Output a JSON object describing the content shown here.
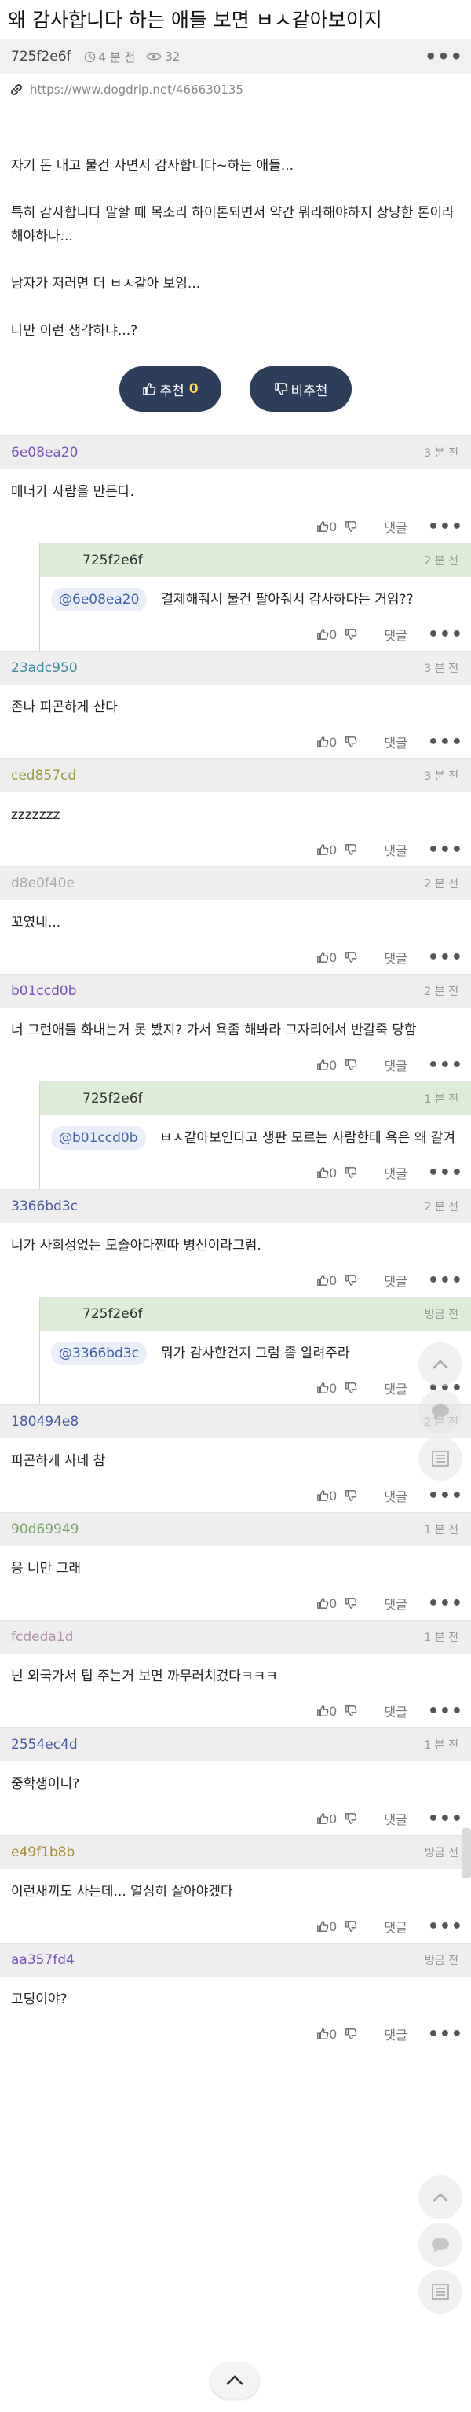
{
  "post": {
    "title": "왜 감사합니다 하는 애들 보면 ㅂㅅ같아보이지",
    "author": "725f2e6f",
    "time": "4 분 전",
    "views": "32",
    "more": "•••",
    "url": "https://www.dogdrip.net/466630135",
    "paragraphs": [
      "자기 돈 내고 물건 사면서 감사합니다~하는 애들...",
      "특히 감사합니다 말할 때 목소리 하이톤되면서 약간 뭐라해야하지 상냥한 톤이라 해야하나...",
      "남자가 저러면 더 ㅂㅅ같아 보임...",
      "나만 이런 생각하냐...?"
    ],
    "upvote_label": "추천",
    "upvote_count": "0",
    "downvote_label": "비추천"
  },
  "comment_ui": {
    "reply_label": "댓글",
    "dots": "•••",
    "zero": "0"
  },
  "comments": [
    {
      "author": "6e08ea20",
      "time": "3 분 전",
      "text": "매너가 사람을 만든다.",
      "color": "#7a53b8",
      "reply": false
    },
    {
      "author": "725f2e6f",
      "time": "2 분 전",
      "mention": "@6e08ea20",
      "text": "결제해줘서 물건 팔아줘서 감사하다는 거임??",
      "color": "#333333",
      "reply": true
    },
    {
      "author": "23adc950",
      "time": "3 분 전",
      "text": "존나 피곤하게 산다",
      "color": "#3d8aa0",
      "reply": false
    },
    {
      "author": "ced857cd",
      "time": "3 분 전",
      "text": "zzzzzzz",
      "color": "#9a9a3a",
      "reply": false
    },
    {
      "author": "d8e0f40e",
      "time": "2 분 전",
      "text": "꼬였네...",
      "color": "#aaaaaa",
      "reply": false
    },
    {
      "author": "b01ccd0b",
      "time": "2 분 전",
      "text": "너 그런애들 화내는거 못 봤지? 가서 욕좀 해봐라 그자리에서 반갈죽 당함",
      "color": "#7a53b8",
      "reply": false
    },
    {
      "author": "725f2e6f",
      "time": "1 분 전",
      "mention": "@b01ccd0b",
      "text": "ㅂㅅ같아보인다고 생판 모르는 사람한테 욕은 왜 갈겨",
      "color": "#333333",
      "reply": true
    },
    {
      "author": "3366bd3c",
      "time": "2 분 전",
      "text": "너가 사회성없는 모솔아다찐따 병신이라그럼.",
      "color": "#4a5aa0",
      "reply": false
    },
    {
      "author": "725f2e6f",
      "time": "방금 전",
      "mention": "@3366bd3c",
      "text": "뭐가 감사한건지 그럼 좀 알려주라",
      "color": "#333333",
      "reply": true
    },
    {
      "author": "180494e8",
      "time": "2 분 전",
      "text": "피곤하게 사네 참",
      "color": "#4a5aa0",
      "reply": false
    },
    {
      "author": "90d69949",
      "time": "1 분 전",
      "text": "응 너만 그래",
      "color": "#7aa56a",
      "reply": false
    },
    {
      "author": "fcdeda1d",
      "time": "1 분 전",
      "text": "넌 외국가서 팁 주는거 보면 까무러치겄다ㅋㅋㅋ",
      "color": "#b090b0",
      "reply": false
    },
    {
      "author": "2554ec4d",
      "time": "1 분 전",
      "text": "중학생이니?",
      "color": "#4a5aa0",
      "reply": false
    },
    {
      "author": "e49f1b8b",
      "time": "방금 전",
      "text": "이런새끼도 사는데... 열심히 살아야겠다",
      "color": "#a98c3a",
      "reply": false
    },
    {
      "author": "aa357fd4",
      "time": "방금 전",
      "text": "고딩이야?",
      "color": "#7a53b8",
      "reply": false
    }
  ]
}
